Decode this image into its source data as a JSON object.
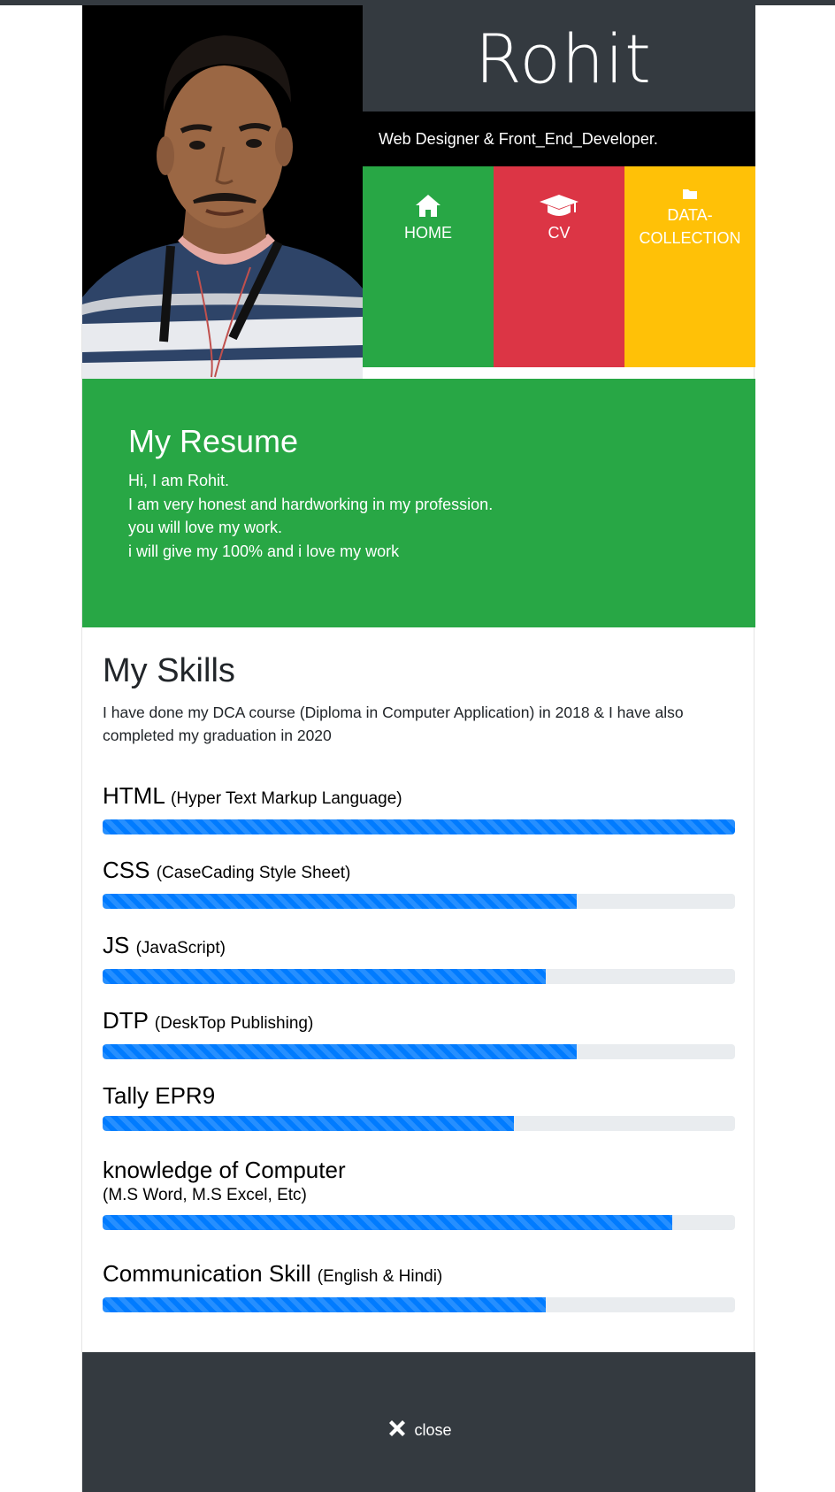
{
  "header": {
    "name": "Rohit",
    "tagline": "Web Designer & Front_End_Developer."
  },
  "nav": {
    "home": {
      "label": "HOME",
      "icon": "home-icon",
      "color": "#28a745"
    },
    "cv": {
      "label": "CV",
      "icon": "graduation-cap-icon",
      "color": "#dc3545"
    },
    "data": {
      "label": "DATA-COLLECTION",
      "icon": "folder-icon",
      "color": "#ffc107"
    }
  },
  "resume": {
    "title": "My Resume",
    "lines": [
      "Hi, I am Rohit.",
      "I am very honest and hardworking in my profession.",
      "you will love my work.",
      "i will give my 100% and i love my work"
    ]
  },
  "skills": {
    "title": "My Skills",
    "intro": "I have done my DCA course (Diploma in Computer Application) in 2018 & I have also completed my graduation in 2020",
    "items": [
      {
        "name": "HTML",
        "detail": "(Hyper Text Markup Language)",
        "percent": 100
      },
      {
        "name": "CSS",
        "detail": "(CaseCading Style Sheet)",
        "percent": 75
      },
      {
        "name": "JS",
        "detail": "(JavaScript)",
        "percent": 70
      },
      {
        "name": "DTP",
        "detail": "(DeskTop Publishing)",
        "percent": 75
      },
      {
        "name": "Tally EPR9",
        "detail": "",
        "percent": 65
      },
      {
        "name": "knowledge of Computer",
        "detail": "(M.S Word, M.S Excel, Etc)",
        "percent": 90
      },
      {
        "name": "Communication Skill",
        "detail": "(English & Hindi)",
        "percent": 70
      }
    ]
  },
  "footer": {
    "close_label": "close",
    "close_icon": "close-icon"
  },
  "colors": {
    "dark": "#343a40",
    "green": "#28a745",
    "red": "#dc3545",
    "yellow": "#ffc107",
    "progress": "#007bff"
  }
}
